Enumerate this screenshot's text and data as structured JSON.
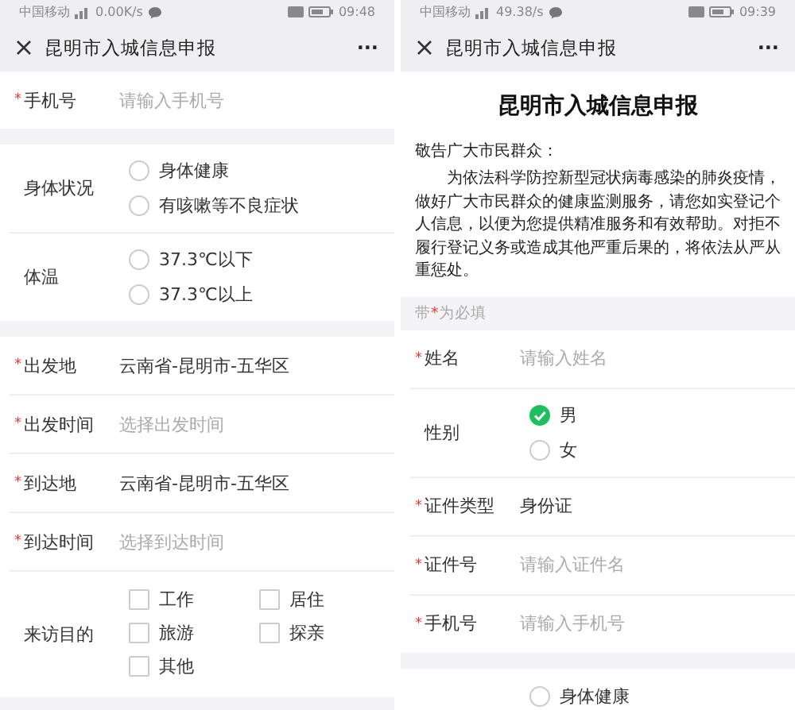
{
  "screens": [
    {
      "status_bar": {
        "carrier": "中国移动",
        "speed": "0.00K/s",
        "time": "09:48"
      },
      "nav": {
        "title": "昆明市入城信息申报",
        "more": "···"
      },
      "sections": [
        {
          "rows": [
            {
              "kind": "input",
              "mark": "*",
              "label": "手机号",
              "placeholder": "请输入手机号"
            }
          ]
        },
        {
          "rows": [
            {
              "kind": "radio",
              "label": "身体状况",
              "options": [
                {
                  "label": "身体健康",
                  "selected": false
                },
                {
                  "label": "有咳嗽等不良症状",
                  "selected": false
                }
              ]
            },
            {
              "kind": "radio",
              "label": "体温",
              "options": [
                {
                  "label": "37.3℃以下",
                  "selected": false
                },
                {
                  "label": "37.3℃以上",
                  "selected": false
                }
              ]
            }
          ]
        },
        {
          "rows": [
            {
              "kind": "value",
              "mark": "*",
              "label": "出发地",
              "value": "云南省-昆明市-五华区"
            },
            {
              "kind": "input",
              "mark": "*",
              "label": "出发时间",
              "placeholder": "选择出发时间"
            },
            {
              "kind": "value",
              "mark": "*",
              "label": "到达地",
              "value": "云南省-昆明市-五华区"
            },
            {
              "kind": "input",
              "mark": "*",
              "label": "到达时间",
              "placeholder": "选择到达时间"
            },
            {
              "kind": "checkbox",
              "label": "来访目的",
              "options": [
                {
                  "label": "工作",
                  "checked": false
                },
                {
                  "label": "居住",
                  "checked": false
                },
                {
                  "label": "旅游",
                  "checked": false
                },
                {
                  "label": "探亲",
                  "checked": false
                },
                {
                  "label": "其他",
                  "checked": false
                }
              ]
            }
          ]
        }
      ]
    },
    {
      "status_bar": {
        "carrier": "中国移动",
        "speed": "49.38/s",
        "time": "09:39"
      },
      "nav": {
        "title": "昆明市入城信息申报",
        "more": "···"
      },
      "intro": {
        "heading": "昆明市入城信息申报",
        "greeting": "敬告广大市民群众：",
        "paragraph": "为依法科学防控新型冠状病毒感染的肺炎疫情，做好广大市民群众的健康监测服务，请您如实登记个人信息，以便为您提供精准服务和有效帮助。对拒不履行登记义务或造成其他严重后果的，将依法从严从重惩处。",
        "note": [
          "带",
          "*",
          "为必填"
        ]
      },
      "sections": [
        {
          "rows": [
            {
              "kind": "input",
              "mark": "*",
              "label": "姓名",
              "placeholder": "请输入姓名"
            },
            {
              "kind": "radio",
              "label": "性别",
              "options": [
                {
                  "label": "男",
                  "selected": true
                },
                {
                  "label": "女",
                  "selected": false
                }
              ]
            },
            {
              "kind": "value",
              "mark": "*",
              "label": "证件类型",
              "value": "身份证"
            },
            {
              "kind": "input",
              "mark": "*",
              "label": "证件号",
              "placeholder": "请输入证件名"
            },
            {
              "kind": "input",
              "mark": "*",
              "label": "手机号",
              "placeholder": "请输入手机号"
            }
          ]
        },
        {
          "rows": [
            {
              "kind": "radio",
              "options": [
                {
                  "label": "身体健康",
                  "selected": false
                }
              ]
            }
          ]
        }
      ]
    }
  ]
}
